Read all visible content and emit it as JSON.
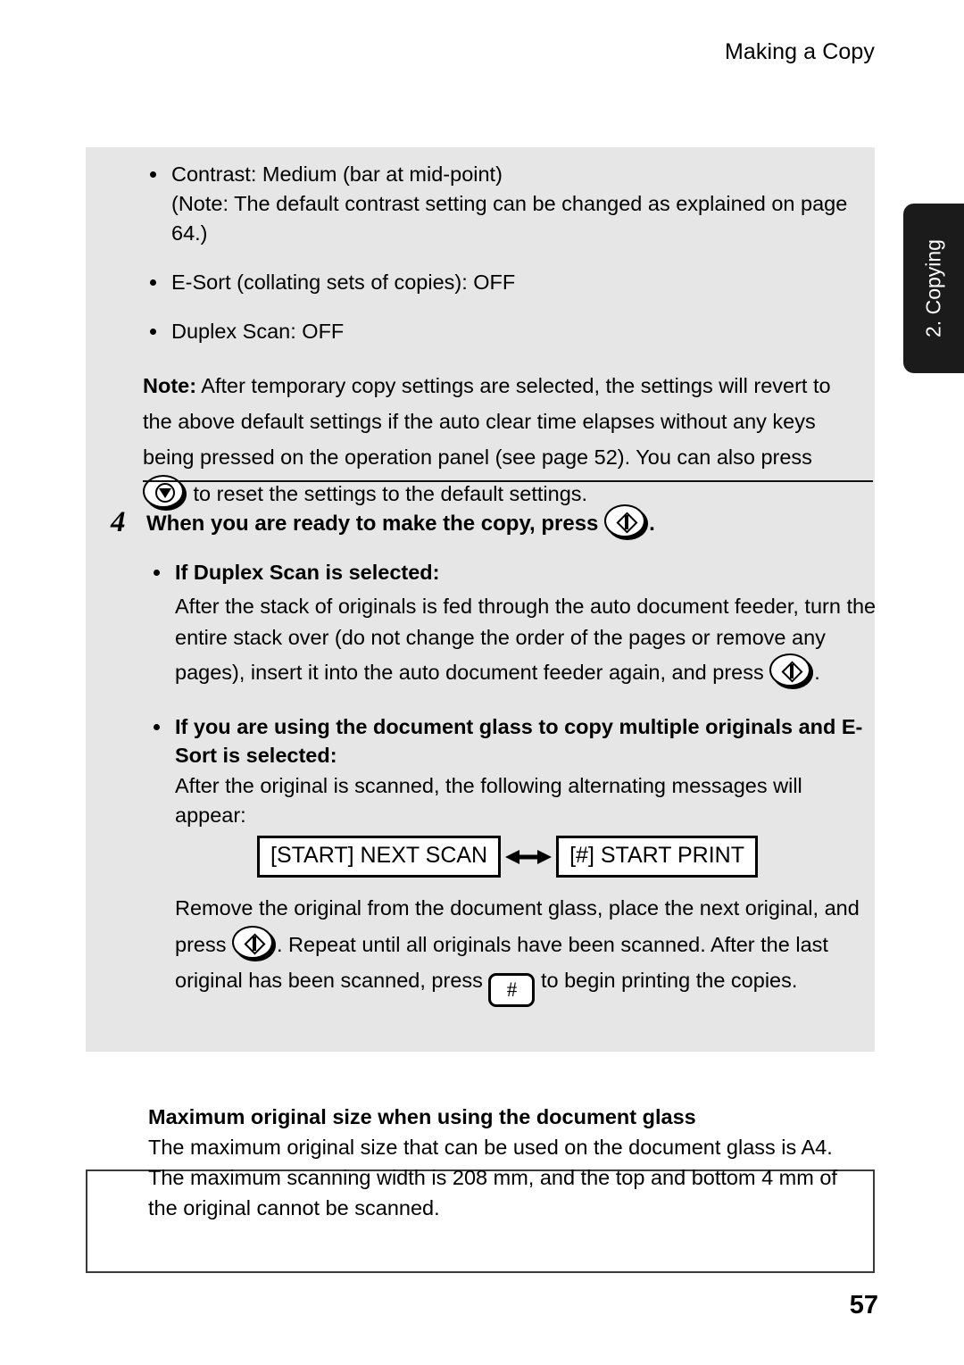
{
  "header": {
    "title": "Making a Copy"
  },
  "side_tab": {
    "label": "2. Copying",
    "background": "#1b1b1b",
    "text_color": "#ffffff"
  },
  "panel": {
    "background": "#e6e6e6",
    "defaults_list": [
      {
        "line1": "Contrast: Medium (bar at mid-point)",
        "line2": "(Note: The default contrast setting can be changed as explained on page",
        "line3": "64.)"
      },
      {
        "line1": "E-Sort (collating sets of copies): OFF"
      },
      {
        "line1": "Duplex Scan: OFF"
      }
    ],
    "note": {
      "label": "Note:",
      "part1": " After temporary copy settings are selected, the settings will revert to the above default settings if the auto clear time elapses without any keys being pressed on the operation panel (see page 52). You can also press",
      "part2": " to reset the settings to the default settings."
    }
  },
  "step": {
    "number": "4",
    "heading_before": "When you are ready to make the copy, press",
    "heading_after": ".",
    "duplex": {
      "bullet_heading": "If Duplex Scan is selected:",
      "body_part1": "After the stack of originals is fed through the auto document feeder, turn the entire stack over (do not change the order of the pages or remove any pages), insert it into the auto document feeder again, and press",
      "body_part2": "."
    },
    "esort": {
      "bullet_heading": "If you are using the document glass to copy multiple originals and E-Sort is selected:",
      "body_intro": "After the original is scanned, the following alternating messages will appear:",
      "display_left": "[START] NEXT SCAN",
      "display_right": "[#] START PRINT",
      "body_part1": "Remove the original from the document glass, place the next original, and press",
      "body_part2": ". Repeat until all originals have been scanned. After the last original has been scanned, press",
      "body_part3": " to begin printing the copies."
    }
  },
  "note_box": {
    "title": "Maximum original size when using the document glass",
    "body": "The maximum original size that can be used on the document glass is A4. The maximum scanning width is 208 mm, and the top and bottom 4 mm of the original cannot be scanned."
  },
  "footer": {
    "page_number": "57"
  },
  "icons": {
    "start_key": "start-key-icon",
    "stop_key": "stop-key-icon",
    "hash_key": "#",
    "arrow": "double-arrow-icon"
  }
}
